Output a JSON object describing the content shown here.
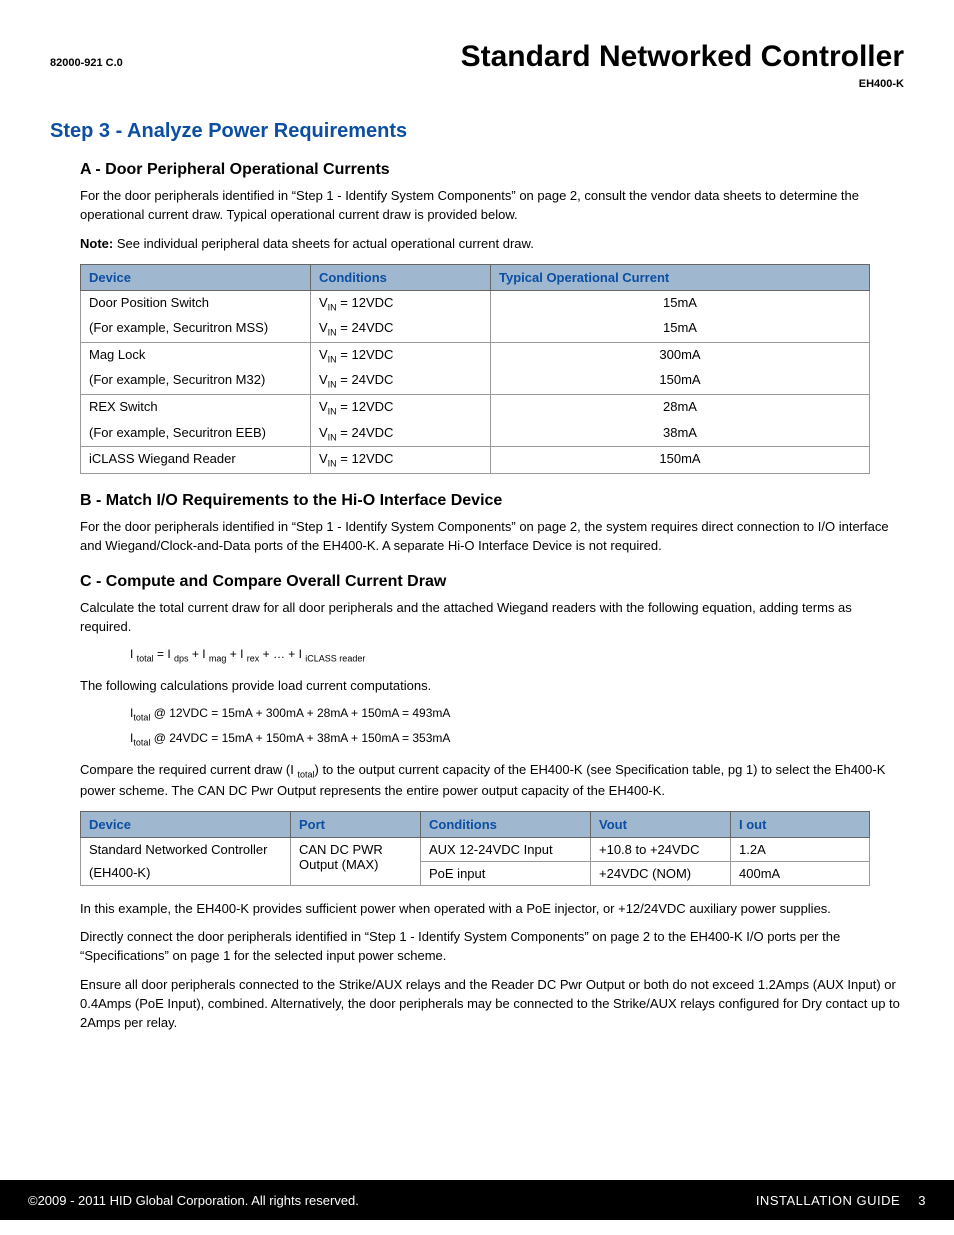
{
  "header": {
    "doc_code": "82000-921 C.0",
    "title": "Standard Networked Controller",
    "model": "EH400-K"
  },
  "step_title": "Step 3 - Analyze Power Requirements",
  "sectionA": {
    "title": "A - Door Peripheral Operational Currents",
    "para1": "For the door peripherals identified in “Step 1 - Identify System Components” on page 2, consult the vendor data sheets to determine the operational current draw. Typical operational current draw is provided below.",
    "note_label": "Note:",
    "note_text": " See individual peripheral data sheets for actual operational current draw.",
    "headers": {
      "c1": "Device",
      "c2": "Conditions",
      "c3": "Typical Operational Current"
    },
    "rows": [
      {
        "device": "Door Position Switch",
        "cond_sub": "IN",
        "cond": " = 12VDC",
        "cur": "15mA"
      },
      {
        "device": "(For example, Securitron MSS)",
        "cond_sub": "IN",
        "cond": " = 24VDC",
        "cur": "15mA"
      },
      {
        "device": "Mag Lock",
        "cond_sub": "IN",
        "cond": " = 12VDC",
        "cur": "300mA"
      },
      {
        "device": "(For example, Securitron M32)",
        "cond_sub": "IN",
        "cond": " = 24VDC",
        "cur": "150mA"
      },
      {
        "device": "REX Switch",
        "cond_sub": "IN",
        "cond": " = 12VDC",
        "cur": "28mA"
      },
      {
        "device": "(For example, Securitron EEB)",
        "cond_sub": "IN",
        "cond": " = 24VDC",
        "cur": "38mA"
      },
      {
        "device": "iCLASS Wiegand Reader",
        "cond_sub": "IN",
        "cond": " = 12VDC",
        "cur": "150mA"
      }
    ]
  },
  "sectionB": {
    "title": "B - Match I/O Requirements to the Hi-O Interface Device",
    "para": "For the door peripherals identified in “Step 1 - Identify System Components” on page 2, the system requires direct connection to I/O interface and Wiegand/Clock-and-Data ports of the EH400-K. A separate Hi-O Interface Device is not required."
  },
  "sectionC": {
    "title": "C - Compute and Compare Overall Current Draw",
    "para1": "Calculate the total current draw for all door peripherals and the attached Wiegand readers with the following equation, adding terms as required.",
    "eq1_pre": "I ",
    "eq1_sub1": "total",
    "eq1_mid1": " = I ",
    "eq1_sub2": "dps",
    "eq1_mid2": " + I ",
    "eq1_sub3": "mag",
    "eq1_mid3": " + I ",
    "eq1_sub4": "rex",
    "eq1_mid4": " + … + I ",
    "eq1_sub5": "iCLASS reader",
    "para2": "The following calculations provide load current computations.",
    "calc1_pre": "I",
    "calc1_sub": "total",
    "calc1_rest": " @ 12VDC = 15mA + 300mA + 28mA + 150mA = 493mA",
    "calc2_pre": "I",
    "calc2_sub": "total",
    "calc2_rest": " @ 24VDC = 15mA + 150mA + 38mA + 150mA = 353mA",
    "para3a": "Compare the required current draw (I ",
    "para3_sub": "total",
    "para3b": ") to the output current capacity of the EH400-K (see Specification table, pg 1) to select the Eh400-K power scheme. The CAN DC Pwr Output represents the entire power output capacity of the EH400-K.",
    "headers2": {
      "c1": "Device",
      "c2": "Port",
      "c3": "Conditions",
      "c4": "Vout",
      "c5": "I out"
    },
    "t2": {
      "dev1": "Standard Networked Controller",
      "dev2": "(EH400-K)",
      "port": "CAN DC PWR Output (MAX)",
      "r1c": "AUX 12-24VDC Input",
      "r1v": "+10.8 to +24VDC",
      "r1i": "1.2A",
      "r2c": "PoE input",
      "r2v": "+24VDC (NOM)",
      "r2i": "400mA"
    },
    "para4": "In this example, the EH400-K provides sufficient power when operated with a PoE injector, or +12/24VDC auxiliary power supplies.",
    "para5": "Directly connect the door peripherals identified in “Step 1 - Identify System Components” on page 2 to the EH400-K I/O ports per the “Specifications” on page 1 for the selected input power scheme.",
    "para6": "Ensure all door peripherals connected to the Strike/AUX relays and the Reader DC Pwr Output or both do not exceed 1.2Amps (AUX Input) or 0.4Amps (PoE Input), combined. Alternatively, the door peripherals may be connected to the Strike/AUX relays configured for Dry contact up to 2Amps per relay."
  },
  "footer": {
    "copyright": "©2009 - 2011 HID Global Corporation. All rights reserved.",
    "guide": "INSTALLATION GUIDE",
    "page": "3"
  }
}
